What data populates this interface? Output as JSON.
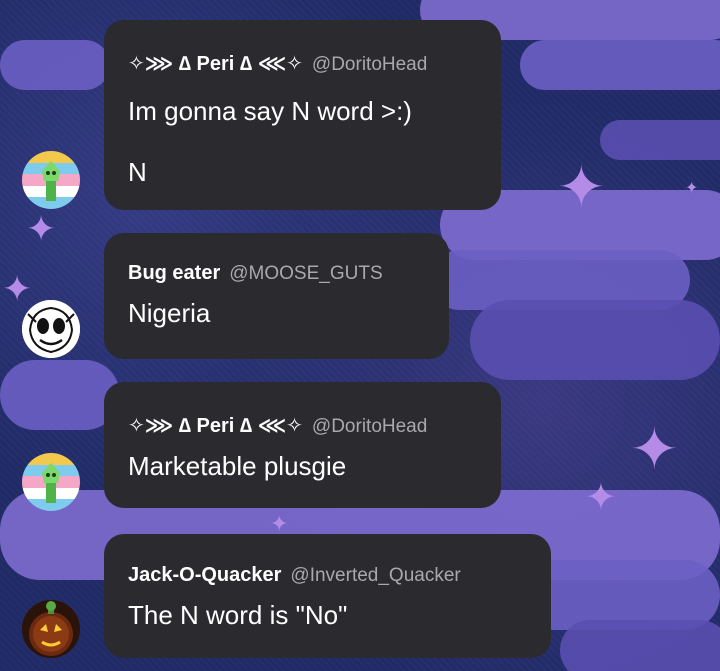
{
  "messages": [
    {
      "display_name": "✧⋙ ∆ Peri ∆ ⋘✧",
      "handle": "@DoritoHead",
      "lines": [
        "Im gonna say N word >:)",
        "N"
      ],
      "avatar_icon": "peridot-flag-avatar"
    },
    {
      "display_name": "Bug eater",
      "handle": "@MOOSE_GUTS",
      "lines": [
        "Nigeria"
      ],
      "avatar_icon": "skull-face-avatar"
    },
    {
      "display_name": "✧⋙ ∆ Peri ∆ ⋘✧",
      "handle": "@DoritoHead",
      "lines": [
        "Marketable plusgie"
      ],
      "avatar_icon": "peridot-flag-avatar"
    },
    {
      "display_name": "Jack-O-Quacker",
      "handle": "@Inverted_Quacker",
      "lines": [
        "The N word is \"No\""
      ],
      "avatar_icon": "pumpkin-duck-avatar"
    }
  ],
  "colors": {
    "bubble": "#2b2a2f",
    "name": "#ffffff",
    "handle": "#a9a9ad",
    "background": "#1f2a66",
    "cloud": "#6b5fc4",
    "sparkle": "#b58be8"
  }
}
